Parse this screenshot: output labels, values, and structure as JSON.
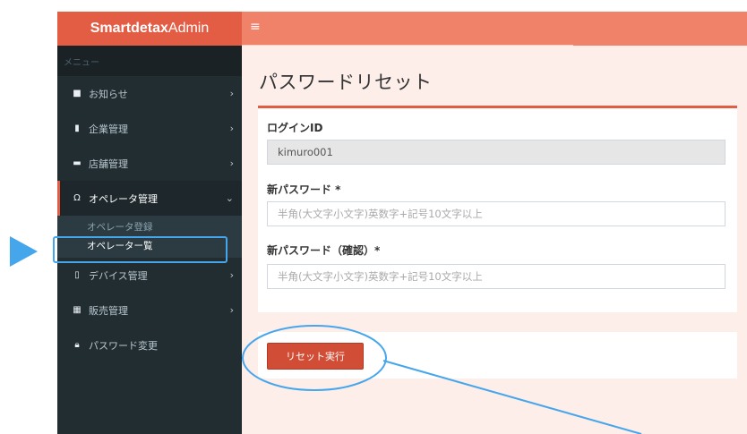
{
  "app": {
    "brand_bold": "Smartdetax",
    "brand_rest": "Admin"
  },
  "topbar": {
    "menu_icon": "hamburger-icon"
  },
  "sidebar": {
    "header": "メニュー",
    "items": [
      {
        "label": "お知らせ",
        "icon": "comment-icon",
        "glyph": "■"
      },
      {
        "label": "企業管理",
        "icon": "building-icon",
        "glyph": "▮"
      },
      {
        "label": "店舗管理",
        "icon": "store-icon",
        "glyph": "▬"
      },
      {
        "label": "オペレータ管理",
        "icon": "headset-icon",
        "glyph": "Ω"
      },
      {
        "label": "デバイス管理",
        "icon": "tablet-icon",
        "glyph": "▯"
      },
      {
        "label": "販売管理",
        "icon": "register-icon",
        "glyph": "▦"
      },
      {
        "label": "パスワード変更",
        "icon": "lock-icon",
        "glyph": "🔒︎"
      }
    ],
    "submenu": [
      {
        "label": "オペレータ登録"
      },
      {
        "label": "オペレーター覧"
      }
    ],
    "chevron_right": "›",
    "chevron_down": "⌄"
  },
  "main": {
    "title": "パスワードリセット",
    "form": {
      "login_id_label": "ログインID",
      "login_id_value": "kimuro001",
      "new_password_label": "新パスワード *",
      "new_password_placeholder": "半角(大文字小文字)英数字+記号10文字以上",
      "confirm_password_label": "新パスワード（確認）*",
      "confirm_password_placeholder": "半角(大文字小文字)英数字+記号10文字以上"
    },
    "reset_button": "リセット実行"
  },
  "colors": {
    "brand": "#e35d45",
    "topbar": "#f0826a",
    "sidebar": "#222d32",
    "content_bg": "#fdeeea",
    "annotation": "#45a6ec"
  }
}
